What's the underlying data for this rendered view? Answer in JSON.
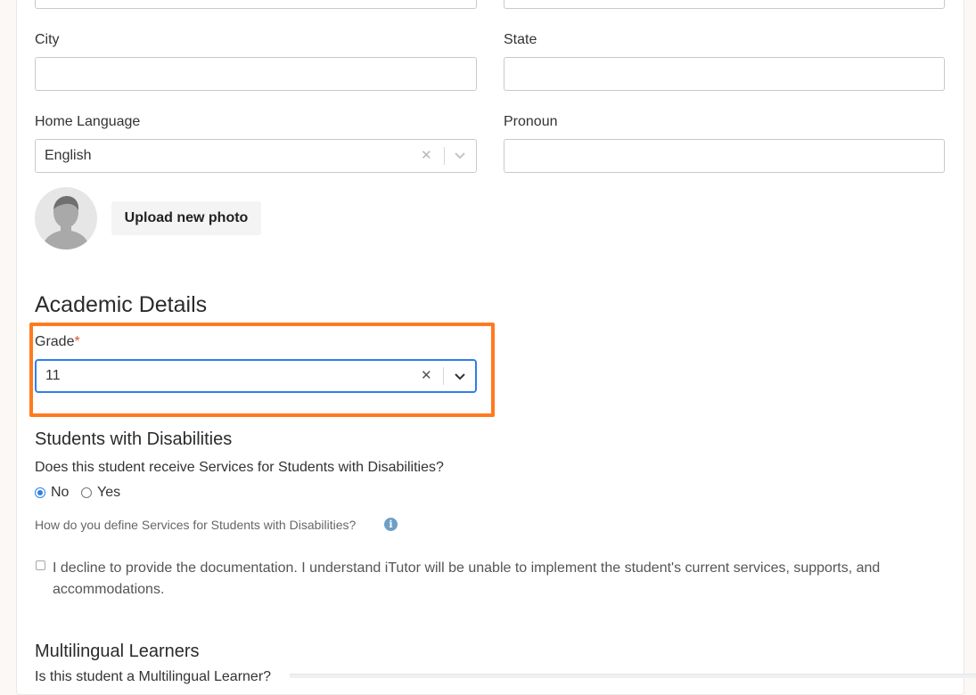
{
  "fields": {
    "city_label": "City",
    "state_label": "State",
    "home_language_label": "Home Language",
    "home_language_value": "English",
    "pronoun_label": "Pronoun"
  },
  "photo": {
    "upload_label": "Upload new photo"
  },
  "academic": {
    "title": "Academic Details",
    "grade_label": "Grade",
    "required_mark": "*",
    "grade_value": "11"
  },
  "disabilities": {
    "title": "Students with Disabilities",
    "question": "Does this student receive Services for Students with Disabilities?",
    "option_no": "No",
    "option_yes": "Yes",
    "selected": "No",
    "define_link": "How do you define Services for Students with Disabilities?",
    "decline_text": "I decline to provide the documentation. I understand iTutor will be unable to implement the student's current services, supports, and accommodations."
  },
  "multilingual": {
    "title": "Multilingual Learners",
    "question": "Is this student a Multilingual Learner?"
  },
  "colors": {
    "highlight": "#ff7a1f",
    "focus": "#2f7fe8",
    "required": "#e0533a",
    "info": "#6f9fc6"
  }
}
